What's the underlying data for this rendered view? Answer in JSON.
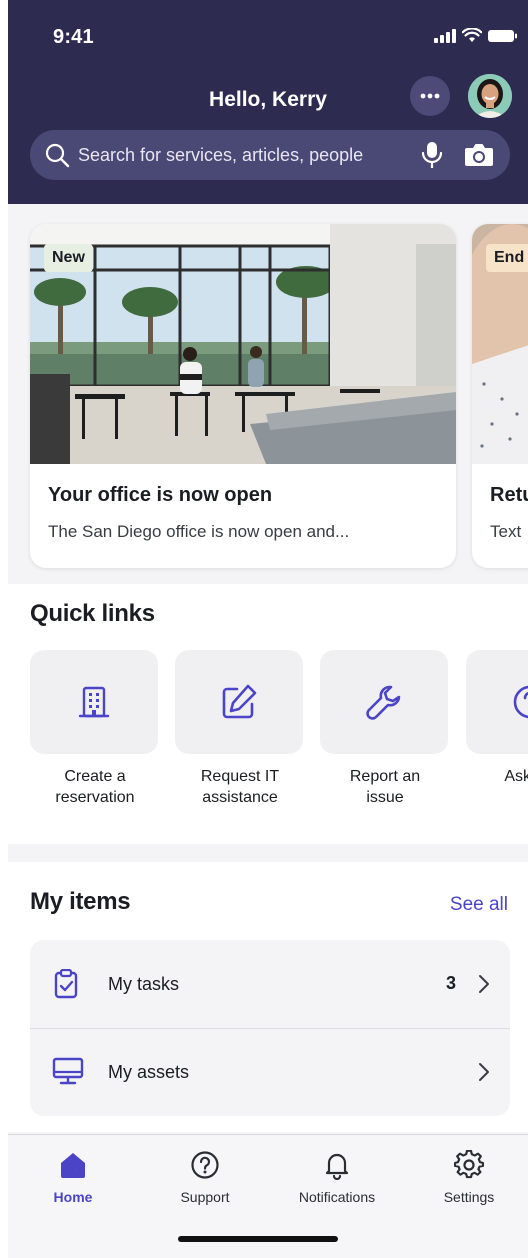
{
  "status_bar": {
    "time": "9:41"
  },
  "header": {
    "greeting": "Hello, Kerry",
    "search_placeholder": "Search for services, articles, people"
  },
  "featured": [
    {
      "badge": "New",
      "title": "Your office is now open",
      "text": "The San Diego office is now open and..."
    },
    {
      "badge": "End",
      "title": "Retu",
      "text": "Text"
    }
  ],
  "quick_links": {
    "title": "Quick links",
    "items": [
      {
        "label": "Create a\nreservation",
        "icon": "building-icon"
      },
      {
        "label": "Request IT\nassistance",
        "icon": "edit-icon"
      },
      {
        "label": "Report an\nissue",
        "icon": "wrench-icon"
      },
      {
        "label": "Ask a q",
        "icon": "question-icon"
      }
    ]
  },
  "my_items": {
    "title": "My items",
    "see_all": "See all",
    "rows": [
      {
        "label": "My tasks",
        "count": "3",
        "icon": "clipboard-check-icon"
      },
      {
        "label": "My assets",
        "count": "",
        "icon": "monitor-icon"
      }
    ]
  },
  "tabs": [
    {
      "label": "Home",
      "icon": "home-icon",
      "active": true
    },
    {
      "label": "Support",
      "icon": "help-circle-icon",
      "active": false
    },
    {
      "label": "Notifications",
      "icon": "bell-icon",
      "active": false
    },
    {
      "label": "Settings",
      "icon": "gear-icon",
      "active": false
    }
  ],
  "colors": {
    "header_bg": "#2d2b4f",
    "accent": "#4b44c6",
    "search_bg": "#4a4875"
  }
}
